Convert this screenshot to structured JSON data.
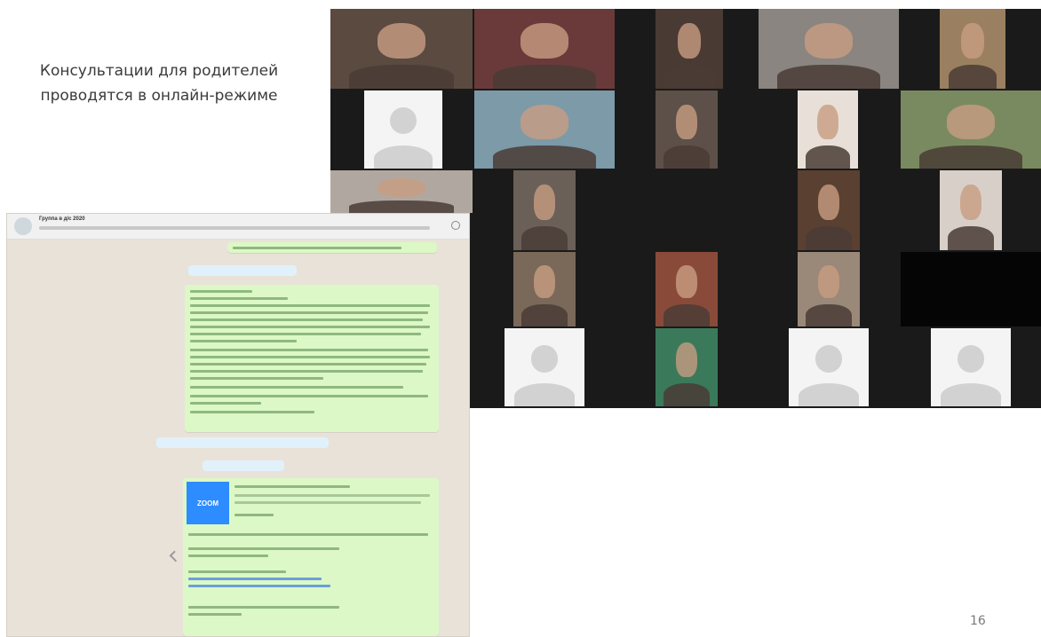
{
  "slide": {
    "title_lines": [
      "Консультации для родителей",
      "проводятся в онлайн-режиме"
    ],
    "page_number": "16"
  },
  "chat": {
    "header_name": "Группа в д/с 2020",
    "zoom_logo_text": "ZOOM"
  },
  "colors": {
    "video_background": "#1a1a1a",
    "chat_background": "#e9e2d9",
    "chat_bubble": "#dcf8c6",
    "zoom_blue": "#2d8cff"
  },
  "icons": [
    "user-placeholder-icon",
    "search-icon",
    "reply-arrow-icon"
  ]
}
